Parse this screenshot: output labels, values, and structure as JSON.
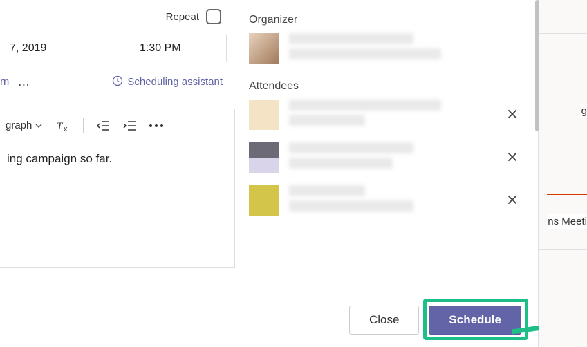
{
  "form": {
    "repeat_label": "Repeat",
    "repeat_checked": false,
    "date_end": "7, 2019",
    "time_end": "1:30 PM",
    "room_fragment": "m",
    "scheduling_assistant_label": "Scheduling assistant"
  },
  "editor": {
    "paragraph_dropdown": "graph",
    "body_fragment": "ing campaign so far."
  },
  "people": {
    "organizer_label": "Organizer",
    "attendees_label": "Attendees"
  },
  "footer": {
    "close_label": "Close",
    "schedule_label": "Schedule"
  },
  "background_calendar": {
    "item1_fragment": "g",
    "item2_fragment": "ns Meeti"
  }
}
